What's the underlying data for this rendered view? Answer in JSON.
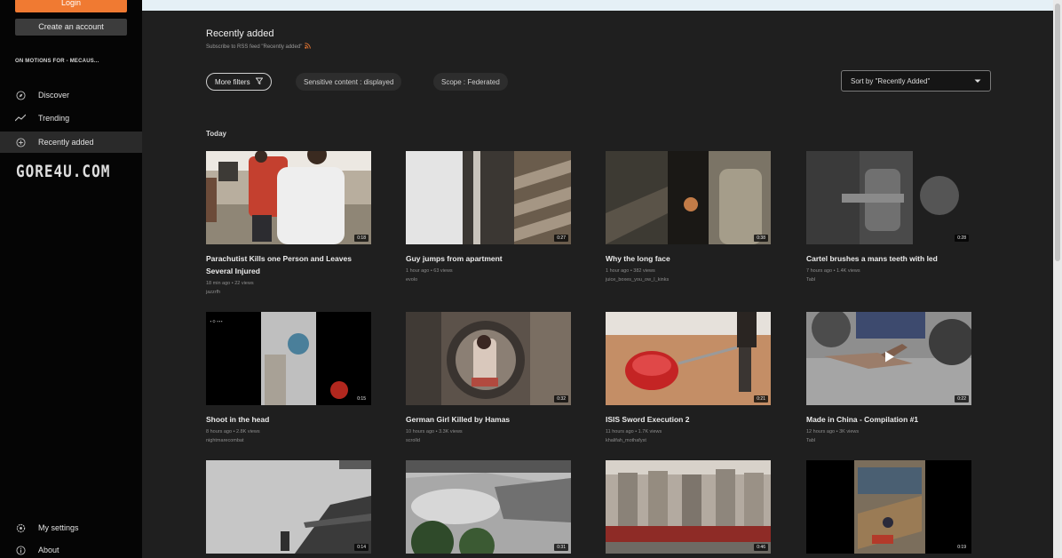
{
  "sidebar": {
    "login_label": "Login",
    "create_account_label": "Create an account",
    "instance_name": "ON MOTIONS FOR - MECAUS...",
    "nav": [
      {
        "label": "Discover",
        "icon": "compass-icon"
      },
      {
        "label": "Trending",
        "icon": "trending-icon"
      },
      {
        "label": "Recently added",
        "icon": "plus-circle-icon"
      }
    ],
    "logo_text": "GORE4U.COM",
    "bottom_nav": [
      {
        "label": "My settings",
        "icon": "gear-icon"
      },
      {
        "label": "About",
        "icon": "info-icon"
      }
    ]
  },
  "header": {
    "title": "Recently added",
    "rss_text": "Subscribe to RSS feed \"Recently added\""
  },
  "filters": {
    "more_filters": "More filters",
    "sensitive": "Sensitive content : displayed",
    "scope": "Scope : Federated",
    "sort": "Sort by \"Recently Added\""
  },
  "section": {
    "label": "Today"
  },
  "videos": [
    {
      "title": "Parachutist Kills one Person and Leaves Several Injured",
      "meta": "18 min ago • 22 views",
      "channel": "jazzrfh",
      "duration": "0:18"
    },
    {
      "title": "Guy jumps from apartment",
      "meta": "1 hour ago • 63 views",
      "channel": "evolo",
      "duration": "0:27"
    },
    {
      "title": "Why the long face",
      "meta": "1 hour ago • 382 views",
      "channel": "juice_boxes_you_ow_I_kinks",
      "duration": "0:38"
    },
    {
      "title": "Cartel brushes a mans teeth with led",
      "meta": "7 hours ago • 1.4K views",
      "channel": "Tabl",
      "duration": "0:28"
    },
    {
      "title": "Shoot in the head",
      "meta": "8 hours ago • 2.8K views",
      "channel": "nightmarecombat",
      "duration": "0:15"
    },
    {
      "title": "German Girl Killed by Hamas",
      "meta": "10 hours ago • 3.3K views",
      "channel": "scrolld",
      "duration": "0:32"
    },
    {
      "title": "ISIS Sword Execution 2",
      "meta": "11 hours ago • 1.7K views",
      "channel": "khalifah_mothafyst",
      "duration": "0:21"
    },
    {
      "title": "Made in China - Compilation #1",
      "meta": "12 hours ago • 3K views",
      "channel": "Tabl",
      "duration": "0:22"
    },
    {
      "title": "",
      "meta": "",
      "channel": "",
      "duration": "0:14"
    },
    {
      "title": "",
      "meta": "",
      "channel": "",
      "duration": "0:31"
    },
    {
      "title": "",
      "meta": "",
      "channel": "",
      "duration": "0:46"
    },
    {
      "title": "",
      "meta": "",
      "channel": "",
      "duration": "0:19"
    }
  ],
  "colors": {
    "accent": "#f07a32",
    "background": "#1f1f1f",
    "sidebar": "#050505"
  }
}
